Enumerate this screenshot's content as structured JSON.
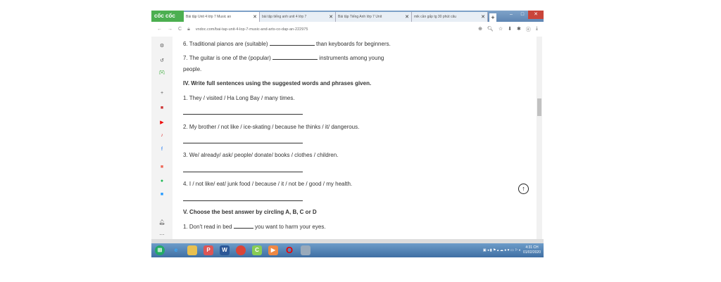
{
  "browser": {
    "brand": "cốc cốc",
    "tabs": [
      {
        "label": "Bài tập Unit 4 lớp 7 Music an",
        "active": true
      },
      {
        "label": "bài tập tiếng anh unit 4 lớp 7",
        "active": false
      },
      {
        "label": "Bài tập Tiếng Anh lớp 7 Unit",
        "active": false
      },
      {
        "label": "mik cần gấp tg 30 phút câu",
        "active": false
      }
    ],
    "url": "vndoc.com/bai-tap-unit-4-lop-7-music-and-arts-co-dap-an-222975"
  },
  "content": {
    "q6a": "6. Traditional pianos are (suitable)",
    "q6b": "than keyboards for beginners.",
    "q7a": "7. The guitar is one of the (popular)",
    "q7b": "instruments among young",
    "q7c": "people.",
    "sec4": "IV. Write full sentences using the suggested words and phrases given.",
    "s1": "1. They / visited / Ha Long Bay / many times.",
    "s2": "2. My brother / not like / ice-skating / because he thinks / it/ dangerous.",
    "s3": "3. We/ already/ ask/ people/ donate/ books / clothes / children.",
    "s4": "4. I / not like/ eat/ junk food / because / it / not be / good / my health.",
    "sec5": "V. Choose the best answer by circling A, B, C or D",
    "c1a": "1. Don't read in bed",
    "c1b": "you want to harm your eyes."
  },
  "taskbar": {
    "time": "4:31 CH",
    "date": "01/02/2020"
  }
}
